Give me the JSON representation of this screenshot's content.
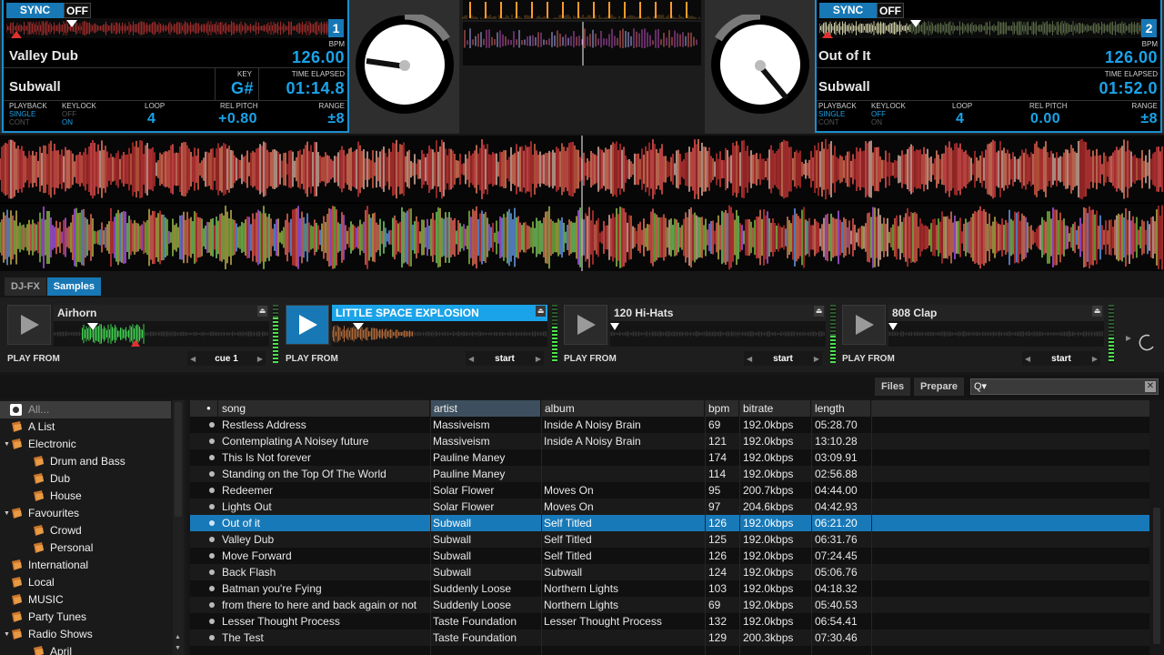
{
  "colors": {
    "accent": "#1aa3e8",
    "selection": "#1879b8",
    "panel_bg": "#000000"
  },
  "deck_left": {
    "sync_label": "SYNC",
    "sync_state": "OFF",
    "deck_number": "1",
    "bpm_label": "BPM",
    "bpm": "126.00",
    "title": "Valley Dub",
    "artist": "Subwall",
    "key_label": "KEY",
    "key": "G#",
    "time_label": "TIME ELAPSED",
    "time": "01:14.8",
    "playback_label": "PLAYBACK",
    "playback_opt1": "SINGLE",
    "playback_opt2": "CONT",
    "keylock_label": "KEYLOCK",
    "keylock_opt1": "OFF",
    "keylock_opt2": "ON",
    "loop_label": "LOOP",
    "loop": "4",
    "pitch_label": "REL PITCH",
    "pitch": "+0.80",
    "range_label": "RANGE",
    "range": "±8"
  },
  "deck_right": {
    "sync_label": "SYNC",
    "sync_state": "OFF",
    "deck_number": "2",
    "bpm_label": "BPM",
    "bpm": "126.00",
    "title": "Out of It",
    "artist": "Subwall",
    "time_label": "TIME ELAPSED",
    "time": "01:52.0",
    "playback_label": "PLAYBACK",
    "playback_opt1": "SINGLE",
    "playback_opt2": "CONT",
    "keylock_label": "KEYLOCK",
    "keylock_opt1": "OFF",
    "keylock_opt2": "ON",
    "loop_label": "LOOP",
    "loop": "4",
    "pitch_label": "REL PITCH",
    "pitch": "0.00",
    "range_label": "RANGE",
    "range": "±8"
  },
  "tabs": {
    "fx": "DJ-FX",
    "samples": "Samples"
  },
  "sampler": {
    "slots": [
      {
        "name": "Airhorn",
        "play_from_label": "PLAY FROM",
        "cue": "cue 1"
      },
      {
        "name": "LITTLE SPACE EXPLOSION",
        "play_from_label": "PLAY FROM",
        "cue": "start"
      },
      {
        "name": "120 Hi-Hats",
        "play_from_label": "PLAY FROM",
        "cue": "start"
      },
      {
        "name": "808 Clap",
        "play_from_label": "PLAY FROM",
        "cue": "start"
      }
    ]
  },
  "browser": {
    "files_label": "Files",
    "prepare_label": "Prepare",
    "search_icon_text": "Q▾",
    "clear_text": "✕",
    "sidebar": [
      {
        "label": "All..."
      },
      {
        "label": "A List"
      },
      {
        "label": "Electronic"
      },
      {
        "label": "Drum and Bass"
      },
      {
        "label": "Dub"
      },
      {
        "label": "House"
      },
      {
        "label": "Favourites"
      },
      {
        "label": "Crowd"
      },
      {
        "label": "Personal"
      },
      {
        "label": "International"
      },
      {
        "label": "Local"
      },
      {
        "label": "MUSIC"
      },
      {
        "label": "Party Tunes"
      },
      {
        "label": "Radio Shows"
      },
      {
        "label": "April"
      }
    ],
    "columns": {
      "marker": "●",
      "song": "song",
      "artist": "artist",
      "album": "album",
      "bpm": "bpm",
      "bitrate": "bitrate",
      "length": "length"
    },
    "rows": [
      {
        "song": "Restless Address",
        "artist": "Massiveism",
        "album": "Inside A Noisy Brain",
        "bpm": "69",
        "bitrate": "192.0kbps",
        "length": "05:28.70"
      },
      {
        "song": "Contemplating A Noisey future",
        "artist": "Massiveism",
        "album": "Inside A Noisy Brain",
        "bpm": "121",
        "bitrate": "192.0kbps",
        "length": "13:10.28"
      },
      {
        "song": "This Is Not forever",
        "artist": "Pauline Maney",
        "album": "",
        "bpm": "174",
        "bitrate": "192.0kbps",
        "length": "03:09.91"
      },
      {
        "song": "Standing on the Top Of The World",
        "artist": "Pauline Maney",
        "album": "",
        "bpm": "114",
        "bitrate": "192.0kbps",
        "length": "02:56.88"
      },
      {
        "song": "Redeemer",
        "artist": "Solar Flower",
        "album": "Moves On",
        "bpm": "95",
        "bitrate": "200.7kbps",
        "length": "04:44.00"
      },
      {
        "song": "Lights Out",
        "artist": "Solar Flower",
        "album": "Moves On",
        "bpm": "97",
        "bitrate": "204.6kbps",
        "length": "04:42.93"
      },
      {
        "song": "Out of it",
        "artist": "Subwall",
        "album": "Self Titled",
        "bpm": "126",
        "bitrate": "192.0kbps",
        "length": "06:21.20"
      },
      {
        "song": "Valley Dub",
        "artist": "Subwall",
        "album": "Self Titled",
        "bpm": "125",
        "bitrate": "192.0kbps",
        "length": "06:31.76"
      },
      {
        "song": "Move Forward",
        "artist": "Subwall",
        "album": "Self Titled",
        "bpm": "126",
        "bitrate": "192.0kbps",
        "length": "07:24.45"
      },
      {
        "song": "Back Flash",
        "artist": "Subwall",
        "album": "Subwall",
        "bpm": "124",
        "bitrate": "192.0kbps",
        "length": "05:06.76"
      },
      {
        "song": "Batman you're Fying",
        "artist": "Suddenly Loose",
        "album": "Northern Lights",
        "bpm": "103",
        "bitrate": "192.0kbps",
        "length": "04:18.32"
      },
      {
        "song": "from there to here and back again or not",
        "artist": "Suddenly Loose",
        "album": "Northern Lights",
        "bpm": "69",
        "bitrate": "192.0kbps",
        "length": "05:40.53"
      },
      {
        "song": "Lesser Thought Process",
        "artist": "Taste Foundation",
        "album": "Lesser Thought Process",
        "bpm": "132",
        "bitrate": "192.0kbps",
        "length": "06:54.41"
      },
      {
        "song": "The Test",
        "artist": "Taste Foundation",
        "album": "",
        "bpm": "129",
        "bitrate": "200.3kbps",
        "length": "07:30.46"
      }
    ]
  }
}
